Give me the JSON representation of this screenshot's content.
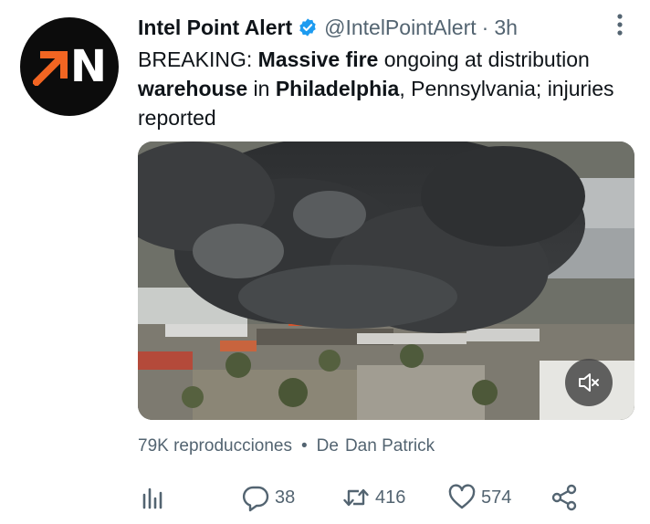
{
  "tweet": {
    "display_name": "Intel Point Alert",
    "handle": "@IntelPointAlert",
    "separator": "·",
    "time": "3h",
    "avatar_logo_text": "N",
    "text": {
      "t1": "BREAKING: ",
      "b1": "Massive fire",
      "t2": " ongoing at distribution ",
      "b2": "warehouse",
      "t3": " in ",
      "b3": "Philadelphia",
      "t4": ", Pennsylvania; injuries reported"
    },
    "views": "79K reproducciones",
    "bullet": "•",
    "by_label": "De",
    "by_name": "Dan Patrick"
  },
  "actions": {
    "replies": "38",
    "retweets": "416",
    "likes": "574"
  },
  "colors": {
    "text": "#0f1419",
    "secondary": "#536471",
    "verified": "#1d9bf0",
    "logo_orange": "#f26522"
  },
  "icons": [
    "verified-badge-icon",
    "more-options-icon",
    "mute-icon",
    "analytics-icon",
    "reply-icon",
    "retweet-icon",
    "like-icon",
    "share-icon"
  ]
}
